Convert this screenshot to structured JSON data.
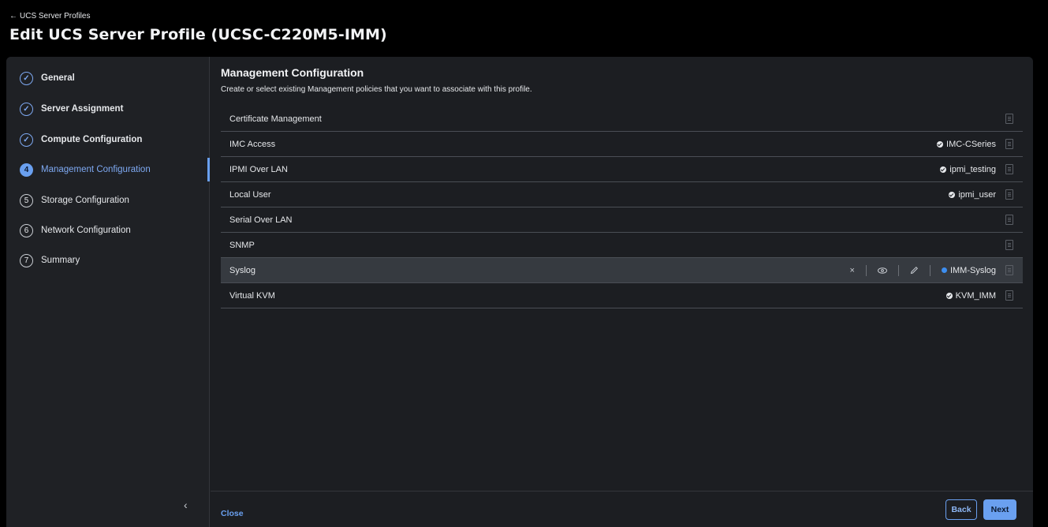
{
  "header": {
    "back_arrow": "←",
    "back_label": "UCS Server Profiles",
    "title": "Edit UCS Server Profile (UCSC-C220M5-IMM)"
  },
  "sidebar": {
    "steps": [
      {
        "num": "✓",
        "label": "General",
        "state": "done"
      },
      {
        "num": "✓",
        "label": "Server Assignment",
        "state": "done"
      },
      {
        "num": "✓",
        "label": "Compute Configuration",
        "state": "done"
      },
      {
        "num": "4",
        "label": "Management Configuration",
        "state": "current"
      },
      {
        "num": "5",
        "label": "Storage Configuration",
        "state": "todo"
      },
      {
        "num": "6",
        "label": "Network Configuration",
        "state": "todo"
      },
      {
        "num": "7",
        "label": "Summary",
        "state": "todo"
      }
    ],
    "collapse_icon": "‹"
  },
  "main": {
    "title": "Management Configuration",
    "description": "Create or select existing Management policies that you want to associate with this profile.",
    "rows": [
      {
        "label": "Certificate Management",
        "policy": ""
      },
      {
        "label": "IMC Access",
        "policy": "IMC-CSeries"
      },
      {
        "label": "IPMI Over LAN",
        "policy": "ipmi_testing"
      },
      {
        "label": "Local User",
        "policy": "ipmi_user"
      },
      {
        "label": "Serial Over LAN",
        "policy": ""
      },
      {
        "label": "SNMP",
        "policy": ""
      },
      {
        "label": "Syslog",
        "policy": "IMM-Syslog",
        "hover": true
      },
      {
        "label": "Virtual KVM",
        "policy": "KVM_IMM"
      }
    ],
    "row_actions": {
      "clear": "×",
      "view": "👁",
      "edit": "✎"
    }
  },
  "footer": {
    "close_label": "Close",
    "back_label": "Back",
    "next_label": "Next"
  },
  "colors": {
    "accent": "#6aa0f0",
    "background": "#1c1e22",
    "hover_row": "#363a40",
    "selected_dot": "#3d8ef0"
  }
}
